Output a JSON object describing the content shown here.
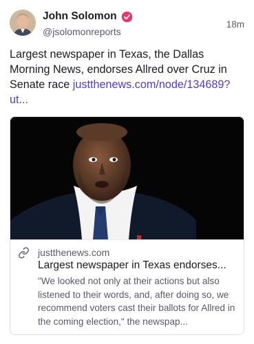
{
  "post": {
    "author": {
      "display_name": "John Solomon",
      "handle": "@jsolomonreports",
      "verified_icon": "verified-badge-icon",
      "badge_color": "#e8356f"
    },
    "timestamp": "18m",
    "text": "Largest newspaper in Texas, the Dallas Morning News, endorses Allred over Cruz in Senate race ",
    "link_text": "justthenews.com/node/134689?ut...",
    "link_color": "#563acc"
  },
  "card": {
    "link_icon": "link-icon",
    "domain": "justthenews.com",
    "title": "Largest newspaper in Texas endorses...",
    "description": "\"We looked not only at their actions but also listened to their words, and, after doing so, we recommend voters cast their ballots for Allred in the coming election,\" the newspap..."
  }
}
